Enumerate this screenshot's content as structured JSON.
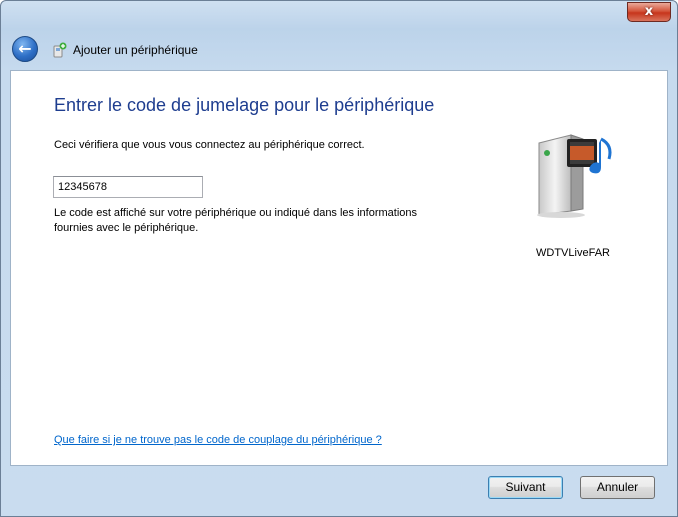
{
  "window": {
    "close_label": "x"
  },
  "nav": {
    "back_icon": "back-arrow-icon",
    "title": "Ajouter un périphérique"
  },
  "main": {
    "heading": "Entrer le code de jumelage pour le périphérique",
    "description": "Ceci vérifiera que vous vous connectez au périphérique correct.",
    "code_value": "12345678",
    "help_text": "Le code est affiché sur votre périphérique ou indiqué dans les informations fournies avec le périphérique.",
    "device_name": "WDTVLiveFAR",
    "help_link": "Que faire si je ne trouve pas le code de couplage du périphérique ?"
  },
  "footer": {
    "next_label": "Suivant",
    "cancel_label": "Annuler"
  },
  "colors": {
    "heading": "#1e3d8f",
    "link": "#0066cc",
    "close_button": "#c7351c"
  }
}
